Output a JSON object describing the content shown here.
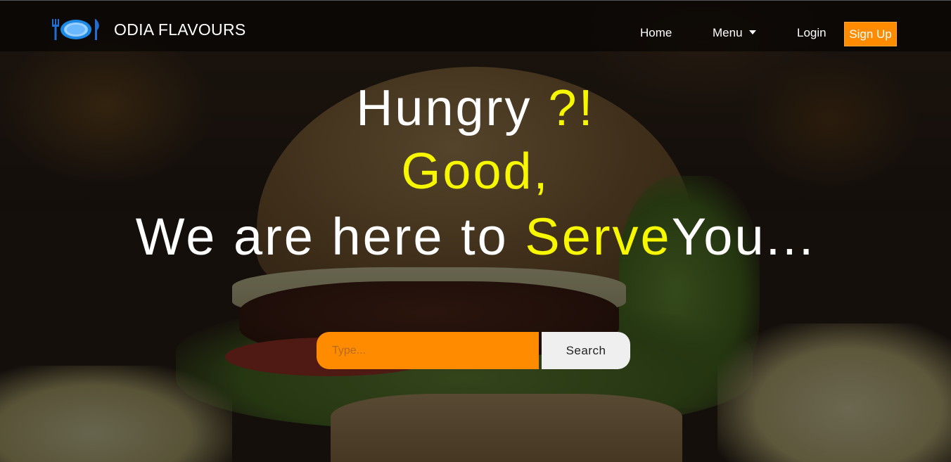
{
  "navbar": {
    "brand": "ODIA FLAVOURS",
    "logo_icon": "plate-cutlery-icon",
    "links": {
      "home": "Home",
      "menu": "Menu",
      "login": "Login",
      "signup": "Sign Up"
    }
  },
  "hero": {
    "line1_a": "Hungry ",
    "line1_b": "?!",
    "line2": "Good,",
    "line3_a": "We are here to ",
    "line3_b": "Serve",
    "line3_c": "You..."
  },
  "search": {
    "placeholder": "Type...",
    "button": "Search"
  },
  "colors": {
    "accent": "#ff8c00",
    "highlight": "#f7f700",
    "text": "#ffffff"
  }
}
